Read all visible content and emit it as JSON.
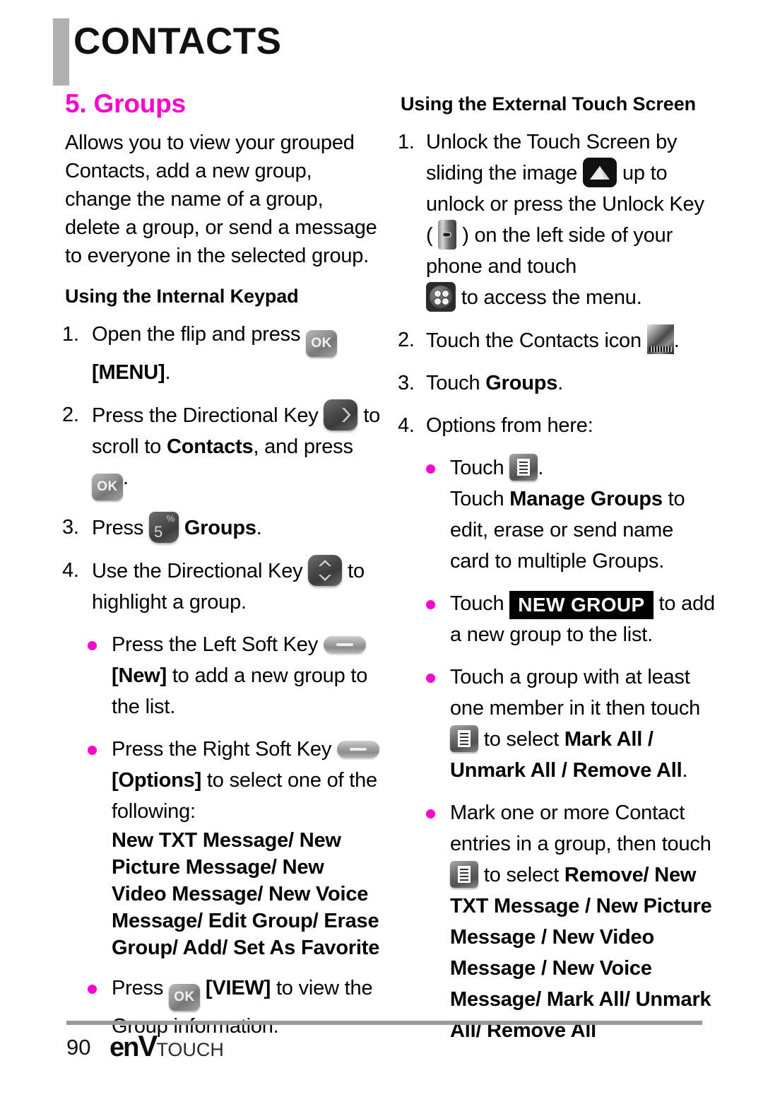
{
  "header": {
    "title": "CONTACTS"
  },
  "left": {
    "section_title": "5. Groups",
    "intro": "Allows you to view your grouped Contacts, add a new group, change the name of a group, delete a group, or send a message to everyone in the selected group.",
    "subhead": "Using the Internal Keypad",
    "step1": {
      "num": "1.",
      "text_a": "Open the flip and press",
      "ok_label": "OK",
      "text_b": "[MENU]",
      "text_c": "."
    },
    "step2": {
      "num": "2.",
      "text_a": "Press the Directional Key",
      "text_b": "to scroll to",
      "bold": "Contacts",
      "text_c": ", and press",
      "ok_label": "OK",
      "text_d": "."
    },
    "step3": {
      "num": "3.",
      "text_a": "Press",
      "key_digit": "5",
      "key_alt": "%",
      "bold": "Groups",
      "text_b": "."
    },
    "step4": {
      "num": "4.",
      "text_a": "Use the Directional Key",
      "text_b": "to highlight a group."
    },
    "bullet1": {
      "text_a": "Press the Left Soft Key",
      "bold": "[New]",
      "text_b": "to add a new group to the list."
    },
    "bullet2": {
      "text_a": "Press the Right Soft Key",
      "bold": "[Options]",
      "text_b": "to select one of the following:",
      "options_bold": "New TXT Message/ New Picture Message/ New Video Message/ New Voice Message/ Edit Group/ Erase Group/ Add/ Set As Favorite"
    },
    "bullet3": {
      "text_a": "Press",
      "ok_label": "OK",
      "bold": "[VIEW]",
      "text_b": "to view the Group information."
    }
  },
  "right": {
    "subhead": "Using the External Touch Screen",
    "step1": {
      "num": "1.",
      "text_a": "Unlock the Touch Screen by sliding the image",
      "text_b": "up to unlock or press the Unlock Key (",
      "text_c": ") on the left side of your phone and touch",
      "text_d": "to access the menu."
    },
    "step2": {
      "num": "2.",
      "text_a": "Touch the Contacts icon",
      "text_b": "."
    },
    "step3": {
      "num": "3.",
      "text_a": "Touch",
      "bold": "Groups",
      "text_b": "."
    },
    "step4": {
      "num": "4.",
      "text_a": "Options from here:"
    },
    "bullet1": {
      "text_a": "Touch",
      "text_b": ".",
      "follow_a": "Touch",
      "follow_bold": "Manage Groups",
      "follow_b": "to edit, erase or send name card to multiple Groups."
    },
    "bullet2": {
      "text_a": "Touch",
      "badge": "NEW GROUP",
      "text_b": "to add a new group to the list."
    },
    "bullet3": {
      "text_a": "Touch a group with at least one member in it then touch",
      "text_b": "to select",
      "bold": "Mark All / Unmark All / Remove All",
      "text_c": "."
    },
    "bullet4": {
      "text_a": "Mark one or more Contact entries in a group, then touch",
      "text_b": "to select",
      "bold_a": "Remove/ New TXT Message / New Picture Message / New Video Message / New Voice Message/ Mark All/ Unmark All/ Remove All"
    }
  },
  "footer": {
    "page_number": "90",
    "logo_main": "en",
    "logo_v": "V",
    "logo_sub": "TOUCH"
  },
  "icons": {
    "ok_key": "ok-key-icon",
    "dir_right": "directional-key-right-icon",
    "dir_updown": "directional-key-updown-icon",
    "num_five": "keypad-5-key-icon",
    "soft_key": "soft-key-icon",
    "unlock_arrow": "unlock-arrow-icon",
    "unlock_button": "unlock-key-icon",
    "menu_dots": "menu-dots-icon",
    "contacts": "contacts-icon",
    "list_menu": "list-menu-icon"
  },
  "colors": {
    "accent_pink": "#ff00cc",
    "header_bar_gray": "#b0b0b0",
    "footer_rule_gray": "#9a9a9a"
  }
}
